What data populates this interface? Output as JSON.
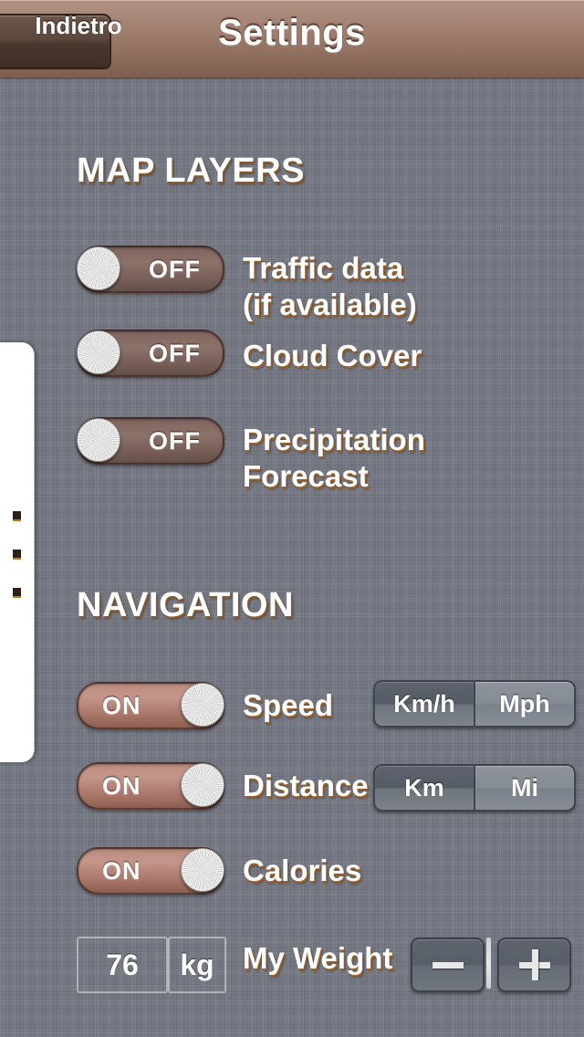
{
  "navbar": {
    "back_label": "Indietro",
    "title": "Settings"
  },
  "sections": [
    {
      "header": "MAP LAYERS",
      "rows": [
        {
          "toggle_state": "OFF",
          "label": "Traffic data\n(if available)"
        },
        {
          "toggle_state": "OFF",
          "label": "Cloud Cover"
        },
        {
          "toggle_state": "OFF",
          "label": "Precipitation\nForecast"
        }
      ]
    },
    {
      "header": "NAVIGATION",
      "rows": [
        {
          "toggle_state": "ON",
          "label": "Speed",
          "segmented": {
            "options": [
              "Km/h",
              "Mph"
            ],
            "selected": "Km/h"
          }
        },
        {
          "toggle_state": "ON",
          "label": "Distance",
          "segmented": {
            "options": [
              "Km",
              "Mi"
            ],
            "selected": "Km"
          }
        },
        {
          "toggle_state": "ON",
          "label": "Calories"
        }
      ],
      "weight_row": {
        "value": "76",
        "unit": "kg",
        "label": "My Weight",
        "decrement_glyph": "minus-icon",
        "increment_glyph": "plus-icon"
      }
    }
  ],
  "labels": {
    "traffic_line1": "Traffic data",
    "traffic_line2": "(if available)",
    "cloud_cover": "Cloud Cover",
    "precip_line1": "Precipitation",
    "precip_line2": "Forecast",
    "speed": "Speed",
    "distance": "Distance",
    "calories": "Calories",
    "my_weight": "My Weight"
  },
  "toggles": {
    "traffic": "OFF",
    "cloud": "OFF",
    "precip": "OFF",
    "speed": "ON",
    "distance": "ON",
    "calories": "ON"
  },
  "segments": {
    "speed_left": "Km/h",
    "speed_right": "Mph",
    "distance_left": "Km",
    "distance_right": "Mi"
  },
  "weight": {
    "value": "76",
    "unit": "kg"
  },
  "colors": {
    "navbar_top": "#b29383",
    "navbar_bottom": "#7d5e4e",
    "background": "#6f737e",
    "toggle_on": "#c5968a",
    "toggle_off": "#8d726a",
    "label_shadow": "#9a5f22",
    "segment_selected": "#565c65",
    "segment_unselected": "#858b93"
  }
}
